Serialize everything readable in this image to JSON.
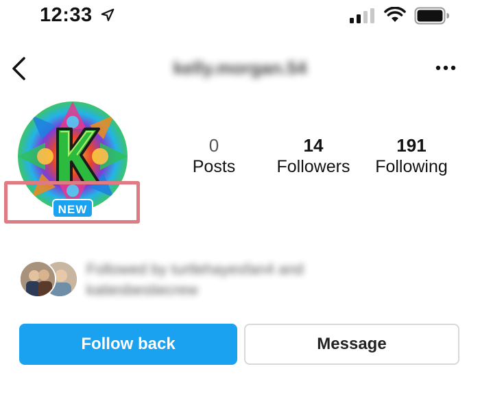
{
  "status_bar": {
    "time": "12:33",
    "icons": [
      "location-arrow-icon",
      "cellular-signal-icon",
      "wifi-icon",
      "battery-icon"
    ]
  },
  "nav": {
    "username": "kelly.morgan.54",
    "username_blurred": true,
    "back_icon": "chevron-left-icon",
    "more_icon": "more-horizontal-icon"
  },
  "profile": {
    "avatar_icon": "kaleidoscope-k-avatar",
    "new_badge": "NEW"
  },
  "stats": {
    "posts": {
      "count": "0",
      "label": "Posts"
    },
    "followers": {
      "count": "14",
      "label": "Followers"
    },
    "following": {
      "count": "191",
      "label": "Following"
    }
  },
  "followed_by": {
    "line1": "Followed by turtlehayesfan4 and",
    "line2": "katiesbestiecrew",
    "blurred": true
  },
  "actions": {
    "follow_back": "Follow back",
    "message": "Message"
  },
  "colors": {
    "accent_blue": "#1aa1f0",
    "highlight_box": "#e07b84",
    "button_border": "#d8d8d8"
  }
}
